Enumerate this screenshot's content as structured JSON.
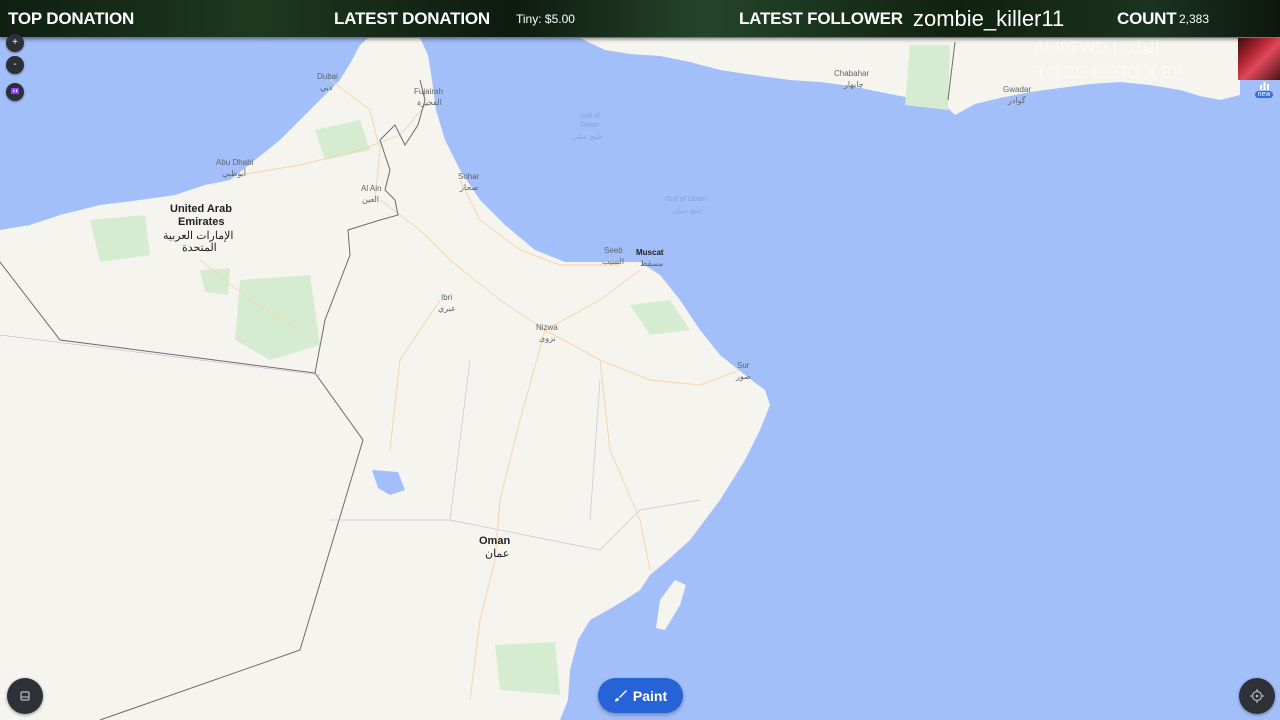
{
  "topbar": {
    "top_donation_label": "TOP DONATION",
    "latest_donation_label": "LATEST DONATION",
    "latest_donation_value": "Tiny: $5.00",
    "latest_follower_label": "LATEST FOLLOWER",
    "latest_follower_value": "zombie_killer11",
    "count_label": "COUNT",
    "count_value": "2,383"
  },
  "overlay": {
    "line1": "ALI8TWD | العلي",
    "line2": "TO BE HERO X EP"
  },
  "map": {
    "countries": {
      "uae_line1": "United Arab",
      "uae_line2": "Emirates",
      "uae_ar1": "الإمارات العربية",
      "uae_ar2": "المتحدة",
      "oman": "Oman",
      "oman_ar": "عمان"
    },
    "cities": {
      "dubai": "Dubai",
      "dubai_ar": "دبي",
      "fujairah": "Fujairah",
      "fujairah_ar": "الفجيرة",
      "abu_dhabi": "Abu Dhabi",
      "abu_dhabi_ar": "أبوظبي",
      "al_ain": "Al Ain",
      "al_ain_ar": "العين",
      "sohar": "Sohar",
      "sohar_ar": "صحار",
      "seeb": "Seeb",
      "seeb_ar": "السيب",
      "muscat": "Muscat",
      "muscat_ar": "مسقط",
      "ibri": "Ibri",
      "ibri_ar": "عبري",
      "nizwa": "Nizwa",
      "nizwa_ar": "نزوى",
      "sur": "Sur",
      "sur_ar": "صور",
      "chabahar": "Chabahar",
      "chabahar_ar": "چابهار",
      "gwadar": "Gwadar",
      "gwadar_ar": "گوادر"
    },
    "seas": {
      "gulf1_line1": "Gulf of",
      "gulf1_line2": "Oman",
      "gulf1_ar": "خليج عمان",
      "gulf2_line1": "Gulf of Oman",
      "gulf2_ar": "خليج عمان"
    }
  },
  "controls": {
    "zoom_in": "+",
    "zoom_out": "-",
    "paint_label": "Paint",
    "stats_badge": "new"
  },
  "colors": {
    "water": "#a3bffa",
    "land": "#f6f4ef",
    "paint_button": "#2563d6"
  }
}
